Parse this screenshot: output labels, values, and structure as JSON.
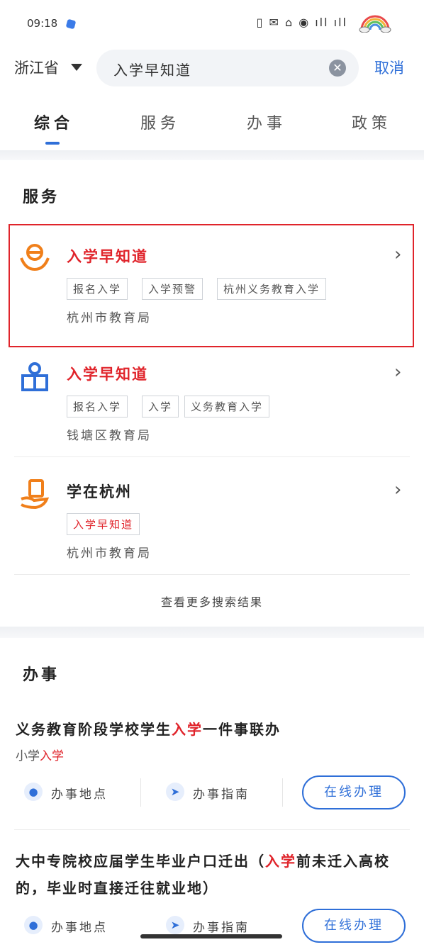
{
  "status_bar": {
    "time": "09:18",
    "icons": "▯ ✉ ⌂ ◉ ıll ıll"
  },
  "search": {
    "region": "浙江省",
    "query": "入学早知道",
    "cancel_label": "取消"
  },
  "tabs": [
    {
      "label": "综合",
      "active": true
    },
    {
      "label": "服务",
      "active": false
    },
    {
      "label": "办事",
      "active": false
    },
    {
      "label": "政策",
      "active": false
    }
  ],
  "services": {
    "title": "服务",
    "items": [
      {
        "title": "入学早知道",
        "tags": [
          "报名入学",
          "入学预警",
          "杭州义务教育入学"
        ],
        "dept": "杭州市教育局",
        "icon": "e-hands-icon",
        "color": "#f07f1a"
      },
      {
        "title": "入学早知道",
        "tags": [
          "报名入学",
          "入学",
          "义务教育入学"
        ],
        "dept": "钱塘区教育局",
        "icon": "school-book-icon",
        "color": "#2f6fd8"
      },
      {
        "title": "学在杭州",
        "tags": [
          "入学早知道"
        ],
        "dept": "杭州市教育局",
        "icon": "hand-book-icon",
        "color": "#f07f1a"
      }
    ],
    "more_label": "查看更多搜索结果"
  },
  "tasks": {
    "title": "办事",
    "items": [
      {
        "title_parts": [
          "义务教育阶段学校学生",
          "入学",
          "一件事联办"
        ],
        "sub_parts": [
          "小学",
          "入学"
        ],
        "location_label": "办事地点",
        "guide_label": "办事指南",
        "button_label": "在线办理"
      },
      {
        "title_parts": [
          "大中专院校应届学生毕业户口迁出（",
          "入学",
          "前未迁入高校的，毕业时直接迁往就业地）"
        ],
        "location_label": "办事地点",
        "guide_label": "办事指南",
        "button_label": "在线办理"
      }
    ]
  }
}
